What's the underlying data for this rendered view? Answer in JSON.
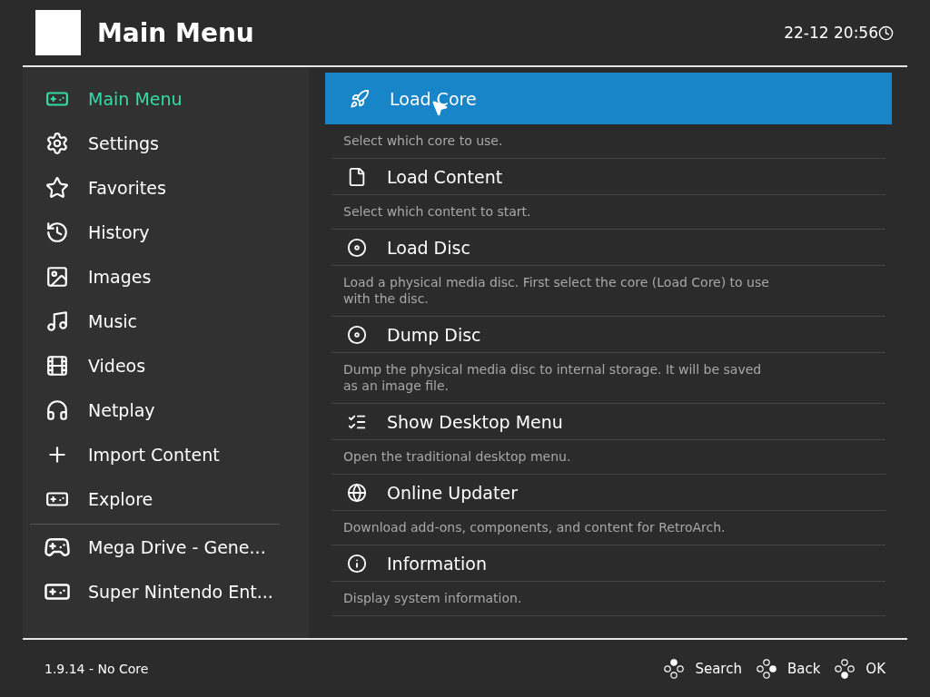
{
  "header": {
    "title": "Main Menu",
    "clock": "22-12 20:56"
  },
  "sidebar": {
    "items": [
      {
        "label": "Main Menu",
        "selected": true
      },
      {
        "label": "Settings",
        "selected": false
      },
      {
        "label": "Favorites",
        "selected": false
      },
      {
        "label": "History",
        "selected": false
      },
      {
        "label": "Images",
        "selected": false
      },
      {
        "label": "Music",
        "selected": false
      },
      {
        "label": "Videos",
        "selected": false
      },
      {
        "label": "Netplay",
        "selected": false
      },
      {
        "label": "Import Content",
        "selected": false
      },
      {
        "label": "Explore",
        "selected": false
      }
    ],
    "playlists": [
      {
        "label": "Mega Drive - Gene...",
        "selected": false
      },
      {
        "label": "Super Nintendo Ent...",
        "selected": false
      }
    ]
  },
  "menu": {
    "items": [
      {
        "label": "Load Core",
        "description": "Select which core to use.",
        "selected": true
      },
      {
        "label": "Load Content",
        "description": "Select which content to start.",
        "selected": false
      },
      {
        "label": "Load Disc",
        "description": "Load a physical media disc. First select the core (Load Core) to use with the disc.",
        "selected": false
      },
      {
        "label": "Dump Disc",
        "description": "Dump the physical media disc to internal storage. It will be saved as an image file.",
        "selected": false
      },
      {
        "label": "Show Desktop Menu",
        "description": "Open the traditional desktop menu.",
        "selected": false
      },
      {
        "label": "Online Updater",
        "description": "Download add-ons, components, and content for RetroArch.",
        "selected": false
      },
      {
        "label": "Information",
        "description": "Display system information.",
        "selected": false
      }
    ]
  },
  "footer": {
    "version": "1.9.14 - No Core",
    "hints": [
      "Search",
      "Back",
      "OK"
    ]
  }
}
